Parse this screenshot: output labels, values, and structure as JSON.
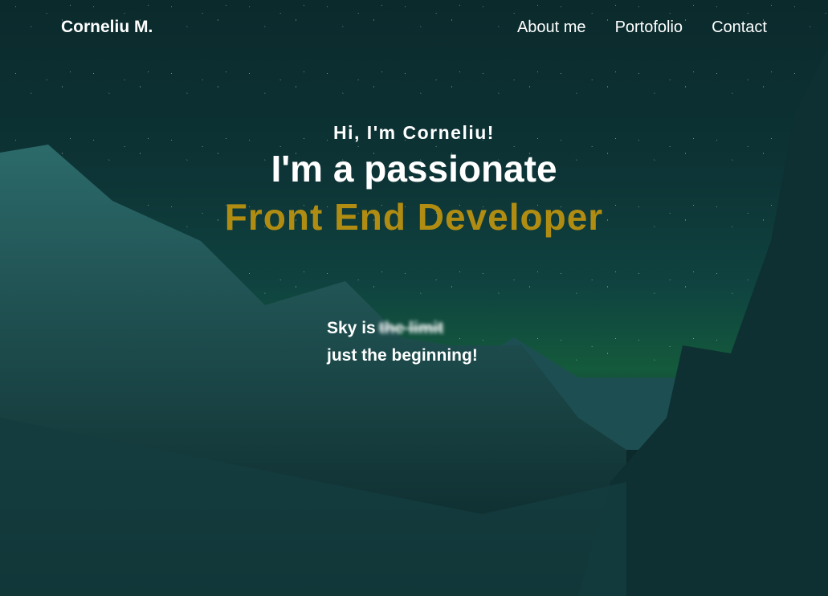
{
  "nav": {
    "logo": "Corneliu M.",
    "links": [
      "About me",
      "Portofolio",
      "Contact"
    ]
  },
  "hero": {
    "greeting": "Hi, I'm Corneliu!",
    "headline": "I'm a passionate",
    "role": "Front End Developer",
    "tagline_start": "Sky is",
    "tagline_struck": "the limit",
    "tagline_end": "just the beginning!"
  },
  "colors": {
    "accent": "#b08d12"
  }
}
